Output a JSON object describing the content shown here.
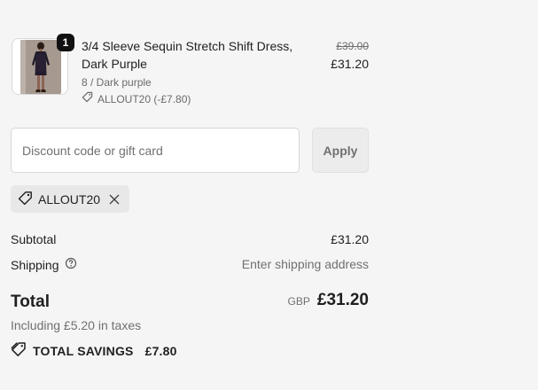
{
  "product": {
    "quantity": "1",
    "title": "3/4 Sleeve Sequin Stretch Shift Dress, Dark Purple",
    "variant": "8 / Dark purple",
    "discount": "ALLOUT20 (-£7.80)",
    "original_price": "£39.00",
    "price": "£31.20",
    "image_icon": "dress-photo"
  },
  "discount_form": {
    "placeholder": "Discount code or gift card",
    "value": "",
    "apply_label": "Apply"
  },
  "applied_code": {
    "code": "ALLOUT20"
  },
  "summary": {
    "subtotal_label": "Subtotal",
    "subtotal_value": "£31.20",
    "shipping_label": "Shipping",
    "shipping_value": "Enter shipping address",
    "total_label": "Total",
    "currency": "GBP",
    "total_value": "£31.20",
    "taxes_note": "Including £5.20 in taxes",
    "savings_label": "TOTAL SAVINGS",
    "savings_value": "£7.80"
  },
  "colors": {
    "background": "#f5f5f5",
    "text": "#1f1f1f",
    "muted": "#707070",
    "badge": "#111111"
  }
}
